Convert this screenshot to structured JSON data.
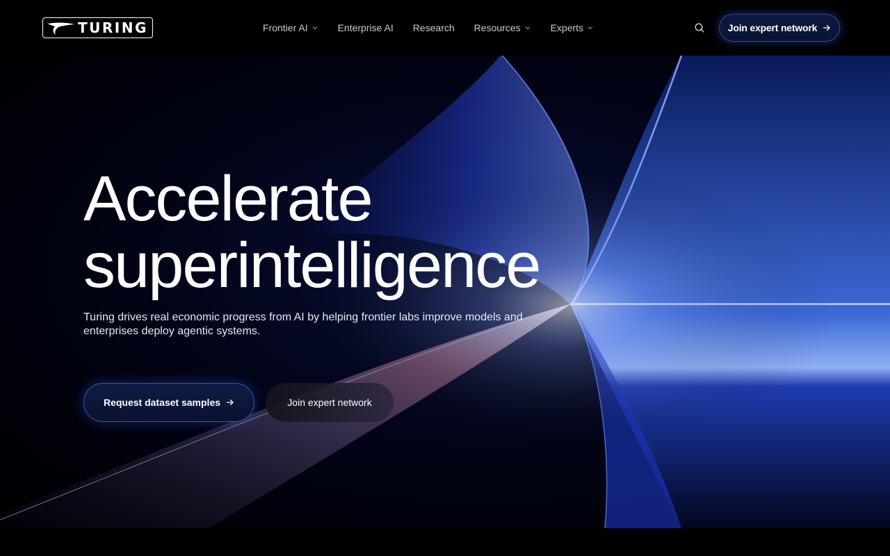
{
  "header": {
    "logo_text": "TURING",
    "nav": [
      {
        "label": "Frontier AI",
        "has_dropdown": true
      },
      {
        "label": "Enterprise AI",
        "has_dropdown": false
      },
      {
        "label": "Research",
        "has_dropdown": false
      },
      {
        "label": "Resources",
        "has_dropdown": true
      },
      {
        "label": "Experts",
        "has_dropdown": true
      }
    ],
    "search_icon": "search-icon",
    "cta_label": "Join expert network"
  },
  "hero": {
    "headline_line1": "Accelerate",
    "headline_line2": "superintelligence",
    "subtext": "Turing drives real economic progress from AI by helping frontier labs improve models and enterprises deploy agentic systems.",
    "primary_button": "Request dataset samples",
    "secondary_button": "Join expert network"
  },
  "colors": {
    "background": "#000000",
    "accent_blue": "#1e3cc8",
    "button_border": "#3a55a8",
    "nav_text": "#c9c9d1"
  }
}
